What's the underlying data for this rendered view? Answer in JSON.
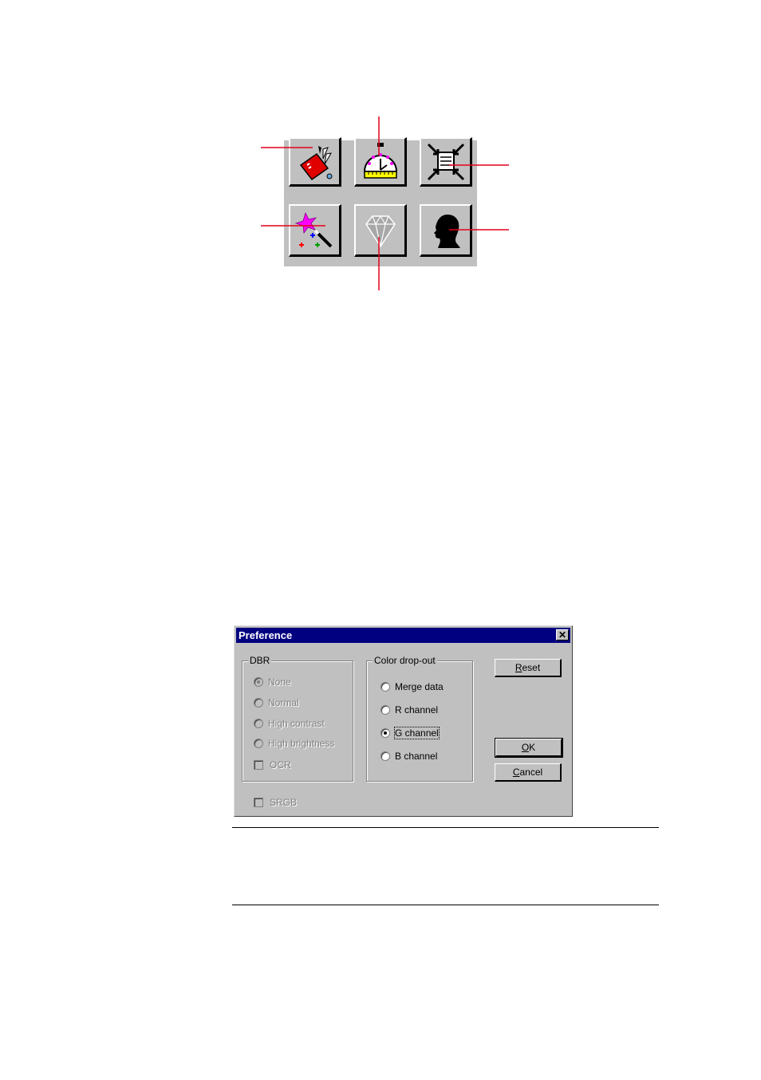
{
  "colors": {
    "callout_line": "#e4001b",
    "titlebar": "#000080",
    "dialog_face": "#c0c0c0"
  },
  "toolbar": {
    "buttons": [
      {
        "icon": "swiss-knife-icon"
      },
      {
        "icon": "stopwatch-icon"
      },
      {
        "icon": "crop-arrows-icon"
      },
      {
        "icon": "magic-wand-icon"
      },
      {
        "icon": "diamond-icon"
      },
      {
        "icon": "silhouette-head-icon"
      }
    ]
  },
  "dialog": {
    "title": "Preference",
    "close_glyph": "✕",
    "dbr": {
      "legend": "DBR",
      "options": [
        "None",
        "Normal",
        "High contrast",
        "High brightness"
      ],
      "selected": "None",
      "ocr_label": "OCR"
    },
    "color_dropout": {
      "legend": "Color drop-out",
      "options": [
        "Merge data",
        "R channel",
        "G channel",
        "B channel"
      ],
      "selected": "G channel"
    },
    "srgb_label": "SRGB",
    "buttons": {
      "reset": {
        "mnemonic": "R",
        "rest": "eset"
      },
      "ok": {
        "mnemonic": "O",
        "rest": "K"
      },
      "cancel": {
        "mnemonic": "C",
        "rest": "ancel"
      }
    }
  }
}
